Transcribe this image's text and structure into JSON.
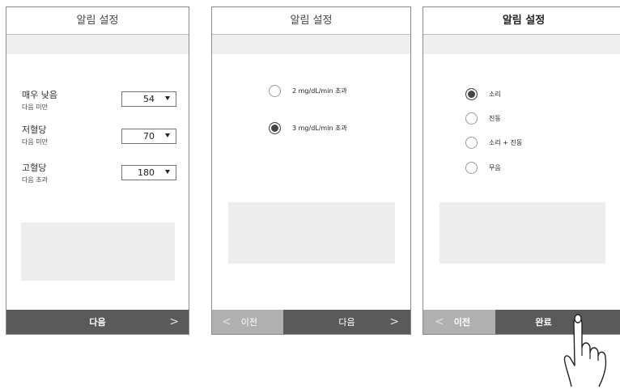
{
  "screen1": {
    "title": "알림 설정",
    "rows": [
      {
        "label": "매우 낮음",
        "sub": "다음 미만",
        "value": "54"
      },
      {
        "label": "저혈당",
        "sub": "다음 미만",
        "value": "70"
      },
      {
        "label": "고혈당",
        "sub": "다음 초과",
        "value": "180"
      }
    ],
    "next_label": "다음",
    "next_chevron": ">"
  },
  "screen2": {
    "title": "알림 설정",
    "options": [
      {
        "label": "2 mg/dL/min 초과",
        "selected": false
      },
      {
        "label": "3 mg/dL/min 초과",
        "selected": true
      }
    ],
    "prev_chevron": "<",
    "prev_label": "이전",
    "next_label": "다음",
    "next_chevron": ">"
  },
  "screen3": {
    "title": "알림 설정",
    "options": [
      {
        "label": "소리",
        "selected": true
      },
      {
        "label": "진동",
        "selected": false
      },
      {
        "label": "소리 + 진동",
        "selected": false
      },
      {
        "label": "무음",
        "selected": false
      }
    ],
    "prev_chevron": "<",
    "prev_label": "이전",
    "done_label": "완료"
  },
  "icons": {
    "dropdown": "triangle-down-icon",
    "pointer": "pointing-hand-icon"
  }
}
